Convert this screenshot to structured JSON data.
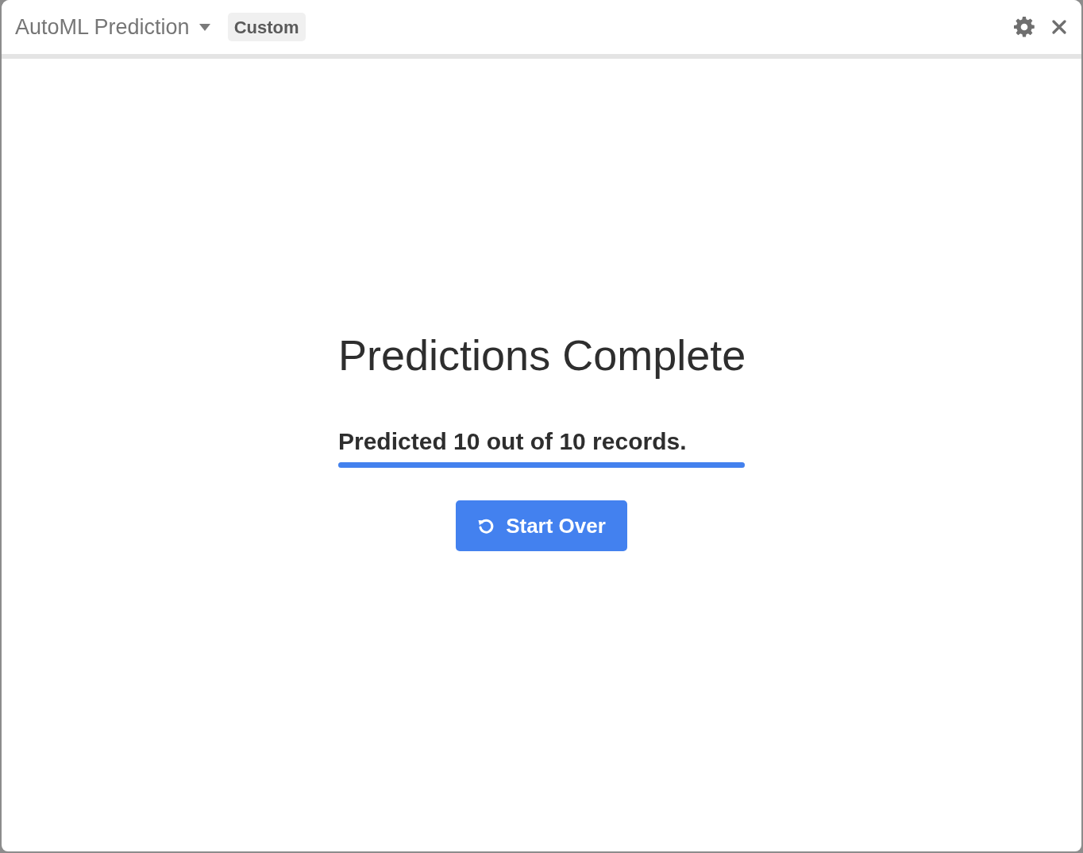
{
  "window": {
    "title": "AutoML Prediction",
    "badge": "Custom"
  },
  "content": {
    "heading": "Predictions Complete",
    "status": "Predicted 10 out of 10 records.",
    "progress": {
      "level": 1
    },
    "button": "Start Over"
  }
}
